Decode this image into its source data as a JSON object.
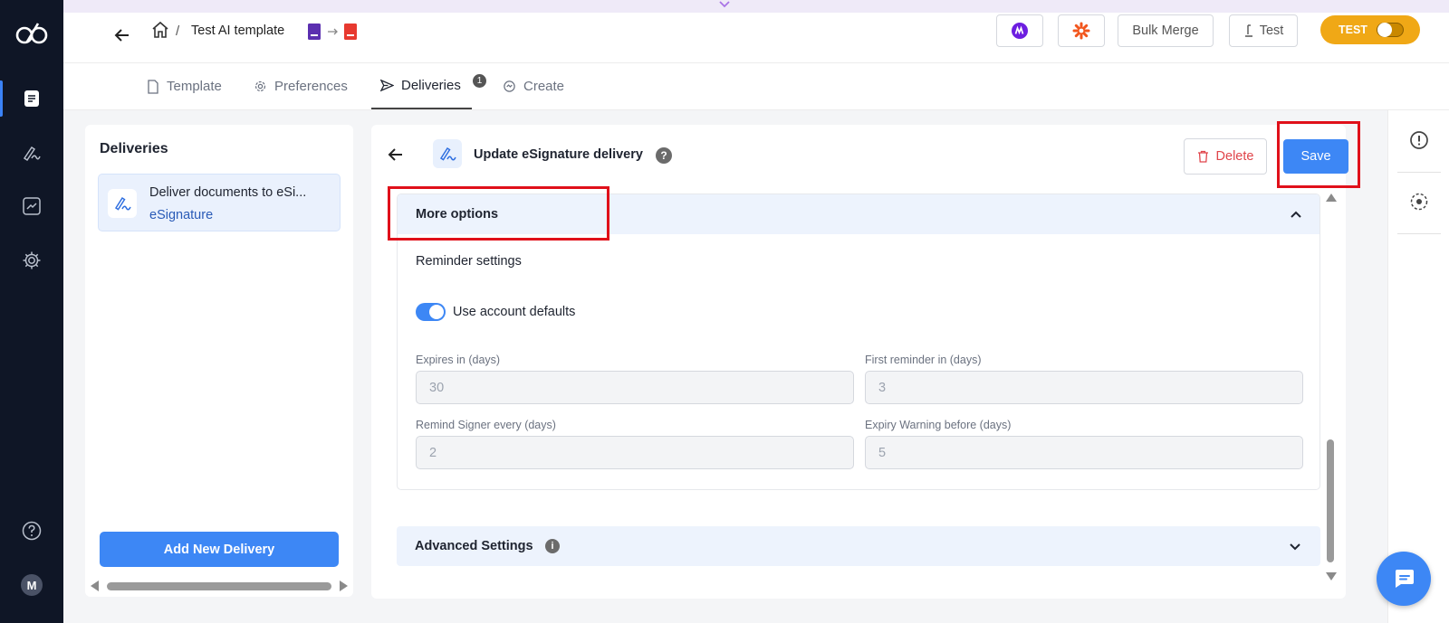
{
  "header": {
    "breadcrumb_separator": "/",
    "title": "Test AI template",
    "bulk_merge_label": "Bulk Merge",
    "test_label": "Test",
    "mode_toggle_label": "TEST"
  },
  "tabs": [
    {
      "label": "Template"
    },
    {
      "label": "Preferences"
    },
    {
      "label": "Deliveries",
      "badge": "1"
    },
    {
      "label": "Create"
    }
  ],
  "deliveries": {
    "title": "Deliveries",
    "items": [
      {
        "name": "Deliver documents to eSi...",
        "type": "eSignature"
      }
    ],
    "add_label": "Add New Delivery"
  },
  "editor": {
    "title": "Update eSignature delivery",
    "help_glyph": "?",
    "delete_label": "Delete",
    "save_label": "Save",
    "more_options_label": "More options",
    "reminder_settings_label": "Reminder settings",
    "use_defaults_label": "Use account defaults",
    "use_defaults_on": true,
    "fields": [
      {
        "label": "Expires in (days)",
        "value": "30"
      },
      {
        "label": "First reminder in (days)",
        "value": "3"
      },
      {
        "label": "Remind Signer every (days)",
        "value": "2"
      },
      {
        "label": "Expiry Warning before (days)",
        "value": "5"
      }
    ],
    "advanced_settings_label": "Advanced Settings",
    "info_glyph": "i"
  },
  "user": {
    "avatar_initial": "M"
  },
  "colors": {
    "sidebar": "#0f1626",
    "accent": "#3d87f5",
    "test_toggle": "#f0a816",
    "danger": "#e0454b",
    "highlight": "#e0101a"
  },
  "icons": {
    "left_nav": [
      "document-icon",
      "signature-icon",
      "analytics-icon",
      "gear-icon",
      "help-icon"
    ],
    "right_rail": [
      "alert-icon",
      "target-icon"
    ],
    "header_integrations": [
      "make-icon",
      "zapier-icon"
    ]
  }
}
